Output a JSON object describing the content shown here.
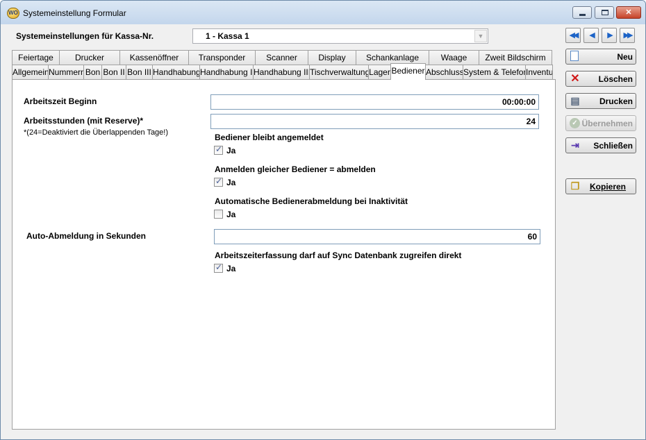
{
  "window": {
    "title": "Systemeinstellung Formular",
    "icon_text": "WO"
  },
  "header": {
    "kassa_label": "Systemeinstellungen für Kassa-Nr.",
    "kassa_value": "1 - Kassa 1"
  },
  "tabs_back": [
    "Feiertage",
    "Drucker",
    "Kassenöffner",
    "Transponder",
    "Scanner",
    "Display",
    "Schankanlage",
    "Waage",
    "Zweit Bildschirm"
  ],
  "tabs_front": [
    "Allgemein",
    "Nummern",
    "Bon",
    "Bon II",
    "Bon III",
    "Handhabung",
    "Handhabung II",
    "Handhabung III",
    "Tischverwaltung",
    "Lager",
    "Bediener",
    "Abschluss",
    "System & Telefon",
    "Inventur"
  ],
  "active_tab": "Bediener",
  "form": {
    "arbeitszeit_beginn_label": "Arbeitszeit Beginn",
    "arbeitszeit_beginn_value": "00:00:00",
    "arbeitsstunden_label": "Arbeitsstunden (mit Reserve)*",
    "arbeitsstunden_note": "*(24=Deaktiviert die Überlappenden Tage!)",
    "arbeitsstunden_value": "24",
    "bleibt_angemeldet_label": "Bediener bleibt angemeldet",
    "bleibt_angemeldet_cb": "Ja",
    "bleibt_angemeldet_checked": true,
    "gleicher_bediener_label": "Anmelden gleicher Bediener = abmelden",
    "gleicher_bediener_cb": "Ja",
    "gleicher_bediener_checked": true,
    "auto_abmeldung_label": "Automatische Bedienerabmeldung bei Inaktivität",
    "auto_abmeldung_cb": "Ja",
    "auto_abmeldung_checked": false,
    "auto_abmeldung_sek_label": "Auto-Abmeldung in Sekunden",
    "auto_abmeldung_sek_value": "60",
    "sync_label": "Arbeitszeiterfassung darf auf Sync Datenbank zugreifen direkt",
    "sync_cb": "Ja",
    "sync_checked": true
  },
  "actions": {
    "neu": "Neu",
    "loeschen": "Löschen",
    "drucken": "Drucken",
    "uebernehmen": "Übernehmen",
    "schliessen": "Schließen",
    "kopieren": "Kopieren"
  },
  "icons": {
    "nav_first": "first-record-icon",
    "nav_prev": "previous-record-icon",
    "nav_next": "next-record-icon",
    "nav_last": "last-record-icon"
  }
}
